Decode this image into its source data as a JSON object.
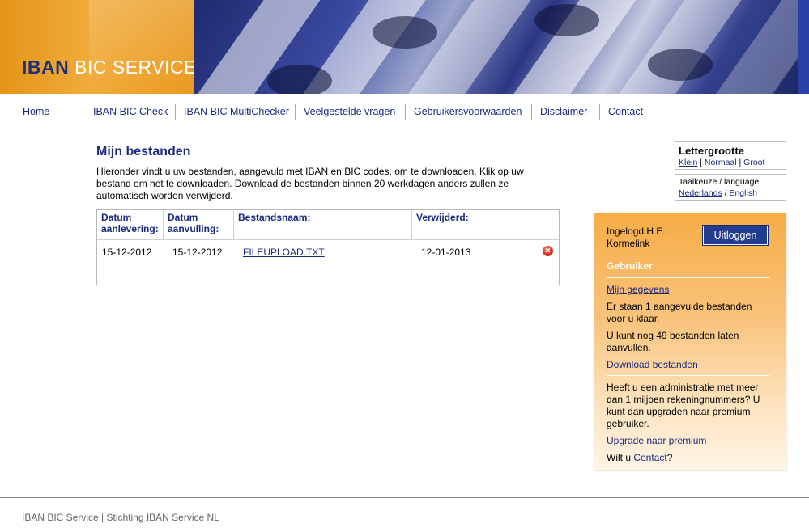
{
  "brand": {
    "word1": "IBAN",
    "word2": "BIC SERVICE"
  },
  "nav": [
    {
      "label": "Home"
    },
    {
      "label": "IBAN BIC Check"
    },
    {
      "label": "IBAN BIC MultiChecker"
    },
    {
      "label": "Veelgestelde vragen"
    },
    {
      "label": "Gebruikersvoorwaarden"
    },
    {
      "label": "Disclaimer"
    },
    {
      "label": "Contact"
    }
  ],
  "main": {
    "title": "Mijn bestanden",
    "intro": "Hieronder vindt u uw bestanden, aangevuld met IBAN en BIC codes, om te downloaden. Klik op uw bestand om het te downloaden. Download de bestanden binnen 20 werkdagen anders zullen ze automatisch worden verwijderd.",
    "table": {
      "headers": [
        "Datum aanlevering:",
        "Datum aanvulling:",
        "Bestandsnaam:",
        "Verwijderd:"
      ],
      "rows": [
        {
          "delivered": "15-12-2012",
          "completed": "15-12-2012",
          "filename": "FILEUPLOAD.TXT",
          "removed": "12-01-2013"
        }
      ]
    }
  },
  "font_size": {
    "title": "Lettergrootte",
    "options": [
      "Klein",
      "Normaal",
      "Groot"
    ]
  },
  "language": {
    "title": "Taalkeuze / language",
    "options": [
      "Nederlands",
      "English"
    ]
  },
  "user_panel": {
    "logged_in": "Ingelogd:H.E. Kormelink",
    "logout_label": "Uitloggen",
    "heading": "Gebruiker",
    "my_details_link": "Mijn gegevens",
    "ready_text": "Er staan 1 aangevulde bestanden voor u klaar.",
    "remaining_text": "U kunt nog 49 bestanden laten aanvullen.",
    "download_link": "Download bestanden",
    "upgrade_text": "Heeft u een administratie met meer dan 1 miljoen rekeningnummers? U kunt dan upgraden naar premium gebruiker.",
    "upgrade_link": "Upgrade naar premium",
    "contact_prefix": "Wilt u ",
    "contact_link": "Contact",
    "contact_suffix": "?"
  },
  "footer": {
    "text": "IBAN BIC Service | Stichting IBAN Service NL"
  },
  "colors": {
    "brand_blue": "#1a2a80",
    "brand_orange": "#f1ab3a",
    "button_blue": "#223c8f"
  },
  "icons": {
    "delete": "delete-icon"
  }
}
